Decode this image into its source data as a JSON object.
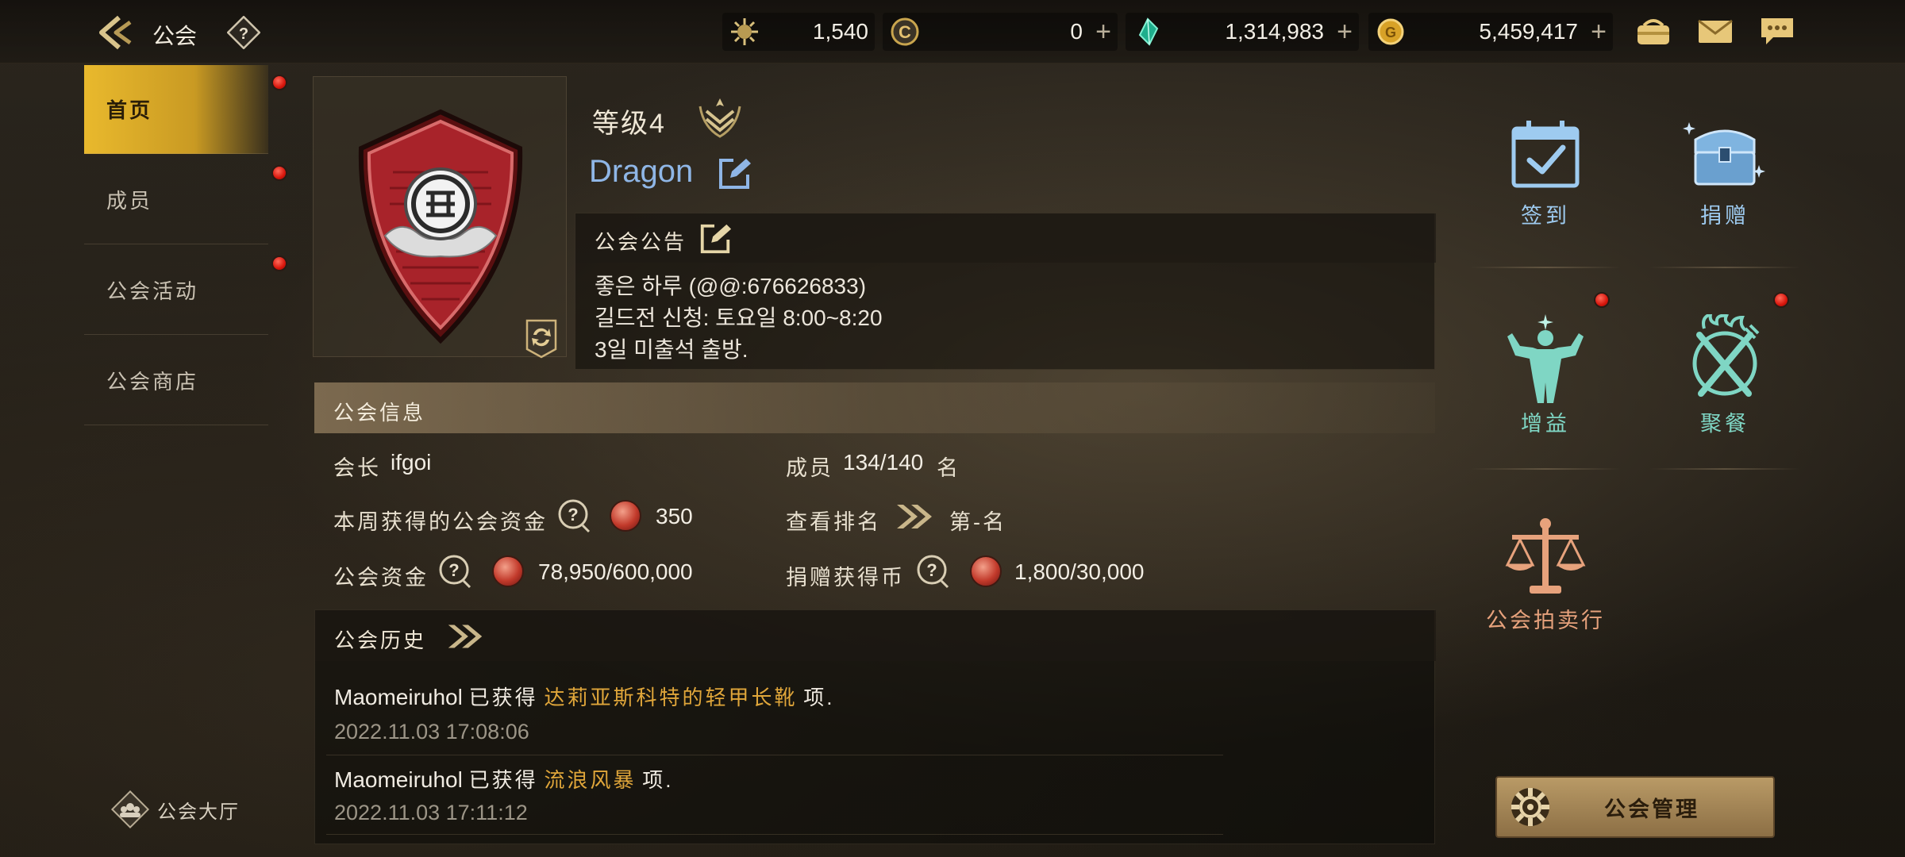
{
  "header": {
    "title": "公会",
    "help_icon": "question-icon",
    "resources": [
      {
        "icon": "sun-medal-icon",
        "value": "1,540",
        "has_plus": false
      },
      {
        "icon": "c-coin-icon",
        "value": "0",
        "has_plus": true
      },
      {
        "icon": "green-crystal-icon",
        "value": "1,314,983",
        "has_plus": true
      },
      {
        "icon": "gold-coin-icon",
        "value": "5,459,417",
        "has_plus": true
      }
    ],
    "plus_symbol": "+",
    "right_icons": [
      "bag-icon",
      "mail-icon",
      "chat-icon"
    ]
  },
  "sidebar": {
    "items": [
      {
        "label": "首页",
        "active": true,
        "badge": true
      },
      {
        "label": "成员",
        "active": false,
        "badge": true
      },
      {
        "label": "公会活动",
        "active": false,
        "badge": true
      },
      {
        "label": "公会商店",
        "active": false,
        "badge": false
      }
    ],
    "hall_label": "公会大厅"
  },
  "guild": {
    "level_text": "等级4",
    "name": "Dragon",
    "notice_title": "公会公告",
    "notice_lines": [
      "좋은 하루 (@@:676626833)",
      "길드전 신청: 토요일 8:00~8:20",
      "3일 미출석 출방."
    ]
  },
  "info": {
    "title": "公会信息",
    "leader_label": "会长",
    "leader_value": "ifgoi",
    "members_label": "成员",
    "members_value": "134/140",
    "members_unit": "名",
    "weekly_funds_label": "本周获得的公会资金",
    "weekly_funds_value": "350",
    "rank_label": "查看排名",
    "rank_value": "第-名",
    "funds_label": "公会资金",
    "funds_value": "78,950/600,000",
    "donate_coin_label": "捐赠获得币",
    "donate_coin_value": "1,800/30,000"
  },
  "history": {
    "title": "公会历史",
    "entries": [
      {
        "player": "Maomeiruhol",
        "pre": "已获得",
        "item": "达莉亚斯科特的轻甲长靴",
        "post": "项.",
        "time": "2022.11.03 17:08:06"
      },
      {
        "player": "Maomeiruhol",
        "pre": "已获得",
        "item": "流浪风暴",
        "post": "项.",
        "time": "2022.11.03 17:11:12"
      }
    ]
  },
  "actions": {
    "checkin": "签到",
    "donate": "捐赠",
    "buff": "增益",
    "feast": "聚餐",
    "auction": "公会拍卖行",
    "manage": "公会管理"
  },
  "colors": {
    "accent_gold": "#e9b92d",
    "name_blue": "#8fb6e6",
    "item_orange": "#e0a63a",
    "teal_action": "#7fd6c4",
    "checkin_blue": "#9ecbf0",
    "auction_orange": "#e7a27c",
    "red_badge": "#d8160c"
  }
}
